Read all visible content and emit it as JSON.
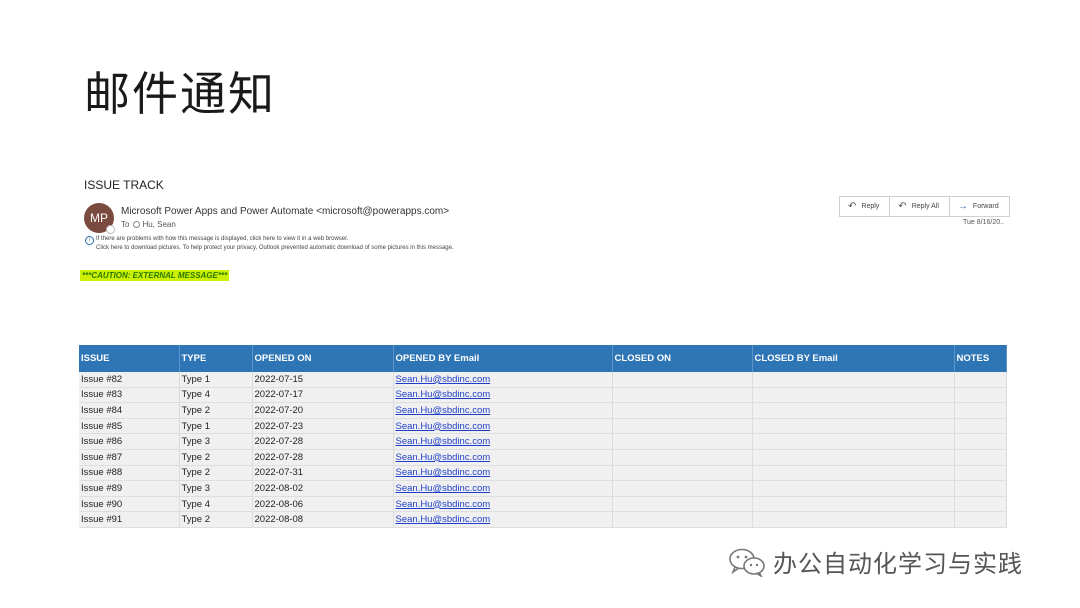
{
  "slide": {
    "title": "邮件通知"
  },
  "email": {
    "subject": "ISSUE TRACK",
    "avatar_initials": "MP",
    "sender": "Microsoft Power Apps and Power Automate <microsoft@powerapps.com>",
    "to_label": "To",
    "recipient": "Hu, Sean",
    "info_line_1": "If there are problems with how this message is displayed, click here to view it in a web browser.",
    "info_line_2": "Click here to download pictures. To help protect your privacy, Outlook prevented automatic download of some pictures in this message.",
    "caution": "***CAUTION: EXTERNAL MESSAGE***",
    "date": "Tue 8/16/20..",
    "actions": {
      "reply": "Reply",
      "reply_all": "Reply All",
      "forward": "Forward"
    }
  },
  "table": {
    "headers": {
      "issue": "ISSUE",
      "type": "TYPE",
      "opened_on": "OPENED ON",
      "opened_by": "OPENED BY Email",
      "closed_on": "CLOSED ON",
      "closed_by": "CLOSED BY Email",
      "notes": "NOTES"
    },
    "rows": [
      {
        "issue": "Issue #82",
        "type": "Type 1",
        "opened_on": "2022-07-15",
        "opened_by": "Sean.Hu@sbdinc.com",
        "closed_on": "",
        "closed_by": "",
        "notes": ""
      },
      {
        "issue": "Issue #83",
        "type": "Type 4",
        "opened_on": "2022-07-17",
        "opened_by": "Sean.Hu@sbdinc.com",
        "closed_on": "",
        "closed_by": "",
        "notes": ""
      },
      {
        "issue": "Issue #84",
        "type": "Type 2",
        "opened_on": "2022-07-20",
        "opened_by": "Sean.Hu@sbdinc.com",
        "closed_on": "",
        "closed_by": "",
        "notes": ""
      },
      {
        "issue": "Issue #85",
        "type": "Type 1",
        "opened_on": "2022-07-23",
        "opened_by": "Sean.Hu@sbdinc.com",
        "closed_on": "",
        "closed_by": "",
        "notes": ""
      },
      {
        "issue": "Issue #86",
        "type": "Type 3",
        "opened_on": "2022-07-28",
        "opened_by": "Sean.Hu@sbdinc.com",
        "closed_on": "",
        "closed_by": "",
        "notes": ""
      },
      {
        "issue": "Issue #87",
        "type": "Type 2",
        "opened_on": "2022-07-28",
        "opened_by": "Sean.Hu@sbdinc.com",
        "closed_on": "",
        "closed_by": "",
        "notes": ""
      },
      {
        "issue": "Issue #88",
        "type": "Type 2",
        "opened_on": "2022-07-31",
        "opened_by": "Sean.Hu@sbdinc.com",
        "closed_on": "",
        "closed_by": "",
        "notes": ""
      },
      {
        "issue": "Issue #89",
        "type": "Type 3",
        "opened_on": "2022-08-02",
        "opened_by": "Sean.Hu@sbdinc.com",
        "closed_on": "",
        "closed_by": "",
        "notes": ""
      },
      {
        "issue": "Issue #90",
        "type": "Type 4",
        "opened_on": "2022-08-06",
        "opened_by": "Sean.Hu@sbdinc.com",
        "closed_on": "",
        "closed_by": "",
        "notes": ""
      },
      {
        "issue": "Issue #91",
        "type": "Type 2",
        "opened_on": "2022-08-08",
        "opened_by": "Sean.Hu@sbdinc.com",
        "closed_on": "",
        "closed_by": "",
        "notes": ""
      }
    ]
  },
  "watermark": {
    "text": "办公自动化学习与实践",
    "icon": "wechat-icon"
  },
  "colors": {
    "table_header": "#2e75b6",
    "caution_bg": "#ccf000",
    "avatar_bg": "#7b4a3e"
  }
}
